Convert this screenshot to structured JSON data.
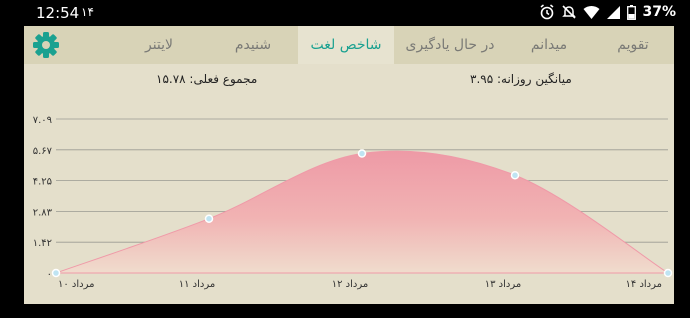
{
  "status_bar": {
    "time": "12:54",
    "notification_text": "۱۴",
    "battery": "37%",
    "icons": [
      "alarm-icon",
      "mute-icon",
      "wifi-icon",
      "signal-icon",
      "battery-icon"
    ]
  },
  "tabs": [
    {
      "label": "تقویم",
      "active": false
    },
    {
      "label": "میدانم",
      "active": false
    },
    {
      "label": "در حال یادگیری",
      "active": false
    },
    {
      "label": "شاخص لغت",
      "active": true
    },
    {
      "label": "شنیدم",
      "active": false
    },
    {
      "label": "لایتنر",
      "active": false
    }
  ],
  "settings_icon": "gear-icon",
  "stats": {
    "daily_average": "میانگین روزانه: ۳.۹۵",
    "current_total": "مجموع فعلی: ۱۵.۷۸"
  },
  "colors": {
    "accent": "#1aa190",
    "tab_bar": "#d8d3b7",
    "background": "#e4dfcb",
    "area_fill_top": "#ee9aa6",
    "point": "#bfe4f2"
  },
  "chart_data": {
    "type": "area",
    "categories": [
      "۱۰ مرداد",
      "۱۱ مرداد",
      "۱۲ مرداد",
      "۱۳ مرداد",
      "۱۴ مرداد"
    ],
    "values": [
      0,
      2.5,
      5.5,
      4.5,
      0
    ],
    "yticks": [
      "۰",
      "۱.۴۲",
      "۲.۸۳",
      "۴.۲۵",
      "۵.۶۷",
      "۷.۰۹"
    ],
    "ylim": [
      0,
      7.09
    ],
    "grid": true
  }
}
